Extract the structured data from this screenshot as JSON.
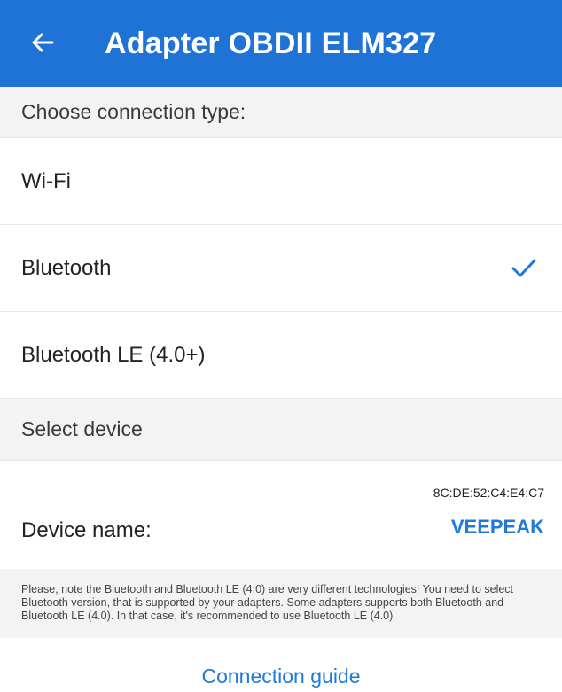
{
  "header": {
    "title": "Adapter OBDII ELM327",
    "back_icon": "arrow-left-icon",
    "color": "#1f73d6"
  },
  "connection_section": {
    "label": "Choose connection type:"
  },
  "connection_options": [
    {
      "label": "Wi-Fi",
      "selected": false
    },
    {
      "label": "Bluetooth",
      "selected": true
    },
    {
      "label": "Bluetooth LE (4.0+)",
      "selected": false
    }
  ],
  "device_section": {
    "label": "Select device"
  },
  "device": {
    "label": "Device name:",
    "mac": "8C:DE:52:C4:E4:C7",
    "name": "VEEPEAK"
  },
  "note": {
    "text": "Please, note the Bluetooth and Bluetooth LE (4.0) are very different technologies! You need to select Bluetooth version, that is supported by your adapters. Some adapters supports both Bluetooth and Bluetooth LE (4.0). In that case, it's recommended to use Bluetooth LE (4.0)"
  },
  "footer": {
    "guide_label": "Connection guide"
  },
  "accent_color": "#1f7ad8"
}
